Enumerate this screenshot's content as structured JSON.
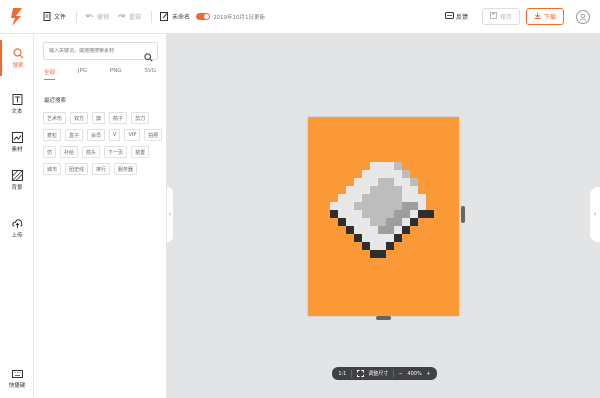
{
  "toolbar": {
    "file_label": "文件",
    "undo_label": "撤销",
    "redo_label": "重做",
    "rename_label": "未命名",
    "autosave_text": "2019年10月1日更新",
    "feedback_label": "反馈",
    "save_label": "保存",
    "download_label": "下载"
  },
  "nav": {
    "items": [
      {
        "label": "搜索",
        "icon": "search-icon"
      },
      {
        "label": "文本",
        "icon": "text-icon"
      },
      {
        "label": "素材",
        "icon": "material-icon"
      },
      {
        "label": "背景",
        "icon": "background-icon"
      },
      {
        "label": "上传",
        "icon": "upload-icon"
      },
      {
        "label": "快捷键",
        "icon": "keyboard-icon"
      }
    ]
  },
  "panel": {
    "search_placeholder": "输入关键词，或拖拽搜索素材",
    "tabs": [
      "全部",
      "JPG",
      "PNG",
      "SVG"
    ],
    "recent_title": "最近搜索",
    "tags": [
      "艺术形",
      "双方",
      "旗",
      "箭子",
      "剪刀",
      "麦粒",
      "盒子",
      "会员",
      "V",
      "VIP",
      "拍照",
      "仿",
      "补给",
      "箭头",
      "下一页",
      "装置",
      "城市",
      "团史线",
      "排行",
      "服务器"
    ]
  },
  "zoombar": {
    "ratio_label": "1:1",
    "fit_label": "调整尺寸",
    "minus_label": "−",
    "zoom_value": "400%",
    "plus_label": "+"
  },
  "colors": {
    "accent": "#f06a35",
    "artboard": "#fb9a36"
  }
}
